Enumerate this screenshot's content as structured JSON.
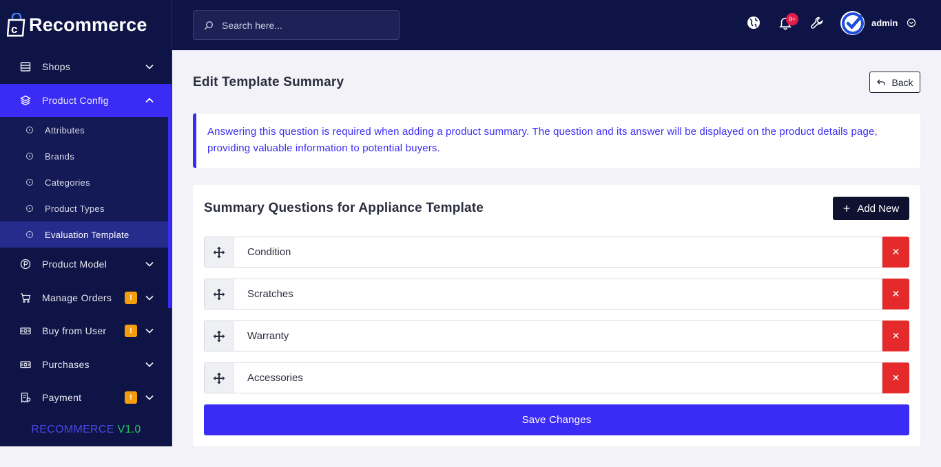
{
  "brand": {
    "name": "Recommerce"
  },
  "sidebar": {
    "items": [
      {
        "label": "Shops"
      },
      {
        "label": "Product Config"
      },
      {
        "label": "Product Model"
      },
      {
        "label": "Manage Orders",
        "badge": "!"
      },
      {
        "label": "Buy from User",
        "badge": "!"
      },
      {
        "label": "Purchases"
      },
      {
        "label": "Payment",
        "badge": "!"
      }
    ],
    "sub_items": [
      {
        "label": "Attributes"
      },
      {
        "label": "Brands"
      },
      {
        "label": "Categories"
      },
      {
        "label": "Product Types"
      },
      {
        "label": "Evaluation Template"
      }
    ],
    "version_name": "RECOMMERCE",
    "version_number": "V1.0"
  },
  "header": {
    "search_placeholder": "Search here...",
    "notification_count": "9+",
    "user_name": "admin"
  },
  "page": {
    "title": "Edit Template Summary",
    "back_label": "Back",
    "info_text": "Answering this question is required when adding a product summary. The question and its answer will be displayed on the product details page, providing valuable information to potential buyers.",
    "card_title": "Summary Questions for Appliance Template",
    "add_label": "Add New",
    "questions": [
      "Condition",
      "Scratches",
      "Warranty",
      "Accessories"
    ],
    "save_label": "Save Changes"
  },
  "colors": {
    "navy": "#0e1445",
    "accent": "#3b2cf5",
    "danger": "#e42a2a",
    "warning": "#f59e0b",
    "success": "#22c55e"
  }
}
